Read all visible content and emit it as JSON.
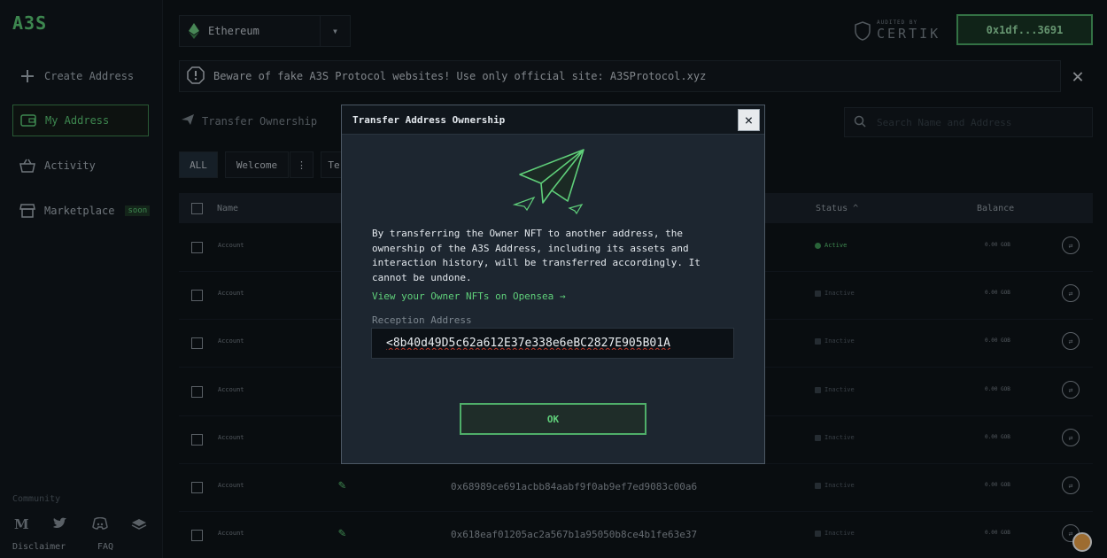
{
  "sidebar": {
    "logo": "A3S",
    "items": [
      {
        "label": "Create Address",
        "icon": "plus-icon"
      },
      {
        "label": "My Address",
        "icon": "wallet-icon"
      },
      {
        "label": "Activity",
        "icon": "basket-icon"
      },
      {
        "label": "Marketplace",
        "icon": "store-icon",
        "badge": "soon"
      }
    ],
    "community_label": "Community",
    "socials": [
      "medium-icon",
      "twitter-icon",
      "discord-icon",
      "gitbook-icon"
    ],
    "footer": {
      "disclaimer": "Disclaimer",
      "faq": "FAQ"
    }
  },
  "header": {
    "network": "Ethereum",
    "audit_small": "AUDITED BY",
    "audit_big": "CERTIK",
    "wallet": "0x1df...3691"
  },
  "banner": {
    "text": "Beware of fake A3S Protocol websites! Use only official site: A3SProtocol.xyz"
  },
  "toolbar": {
    "transfer_tab": "Transfer Ownership",
    "search_placeholder": "Search Name and Address",
    "filters": [
      "ALL",
      "Welcome",
      "⋮",
      "Te"
    ]
  },
  "table": {
    "headers": {
      "name": "Name",
      "status": "Status ^",
      "balance": "Balance"
    },
    "rows": [
      {
        "name": "Account",
        "address": "",
        "status": "Active",
        "balance": "0.00 GOB"
      },
      {
        "name": "Account",
        "address": "",
        "status": "Inactive",
        "balance": "0.00 GOB"
      },
      {
        "name": "Account",
        "address": "",
        "status": "Inactive",
        "balance": "0.00 GOB"
      },
      {
        "name": "Account",
        "address": "",
        "status": "Inactive",
        "balance": "0.00 GOB"
      },
      {
        "name": "Account",
        "address": "",
        "status": "Inactive",
        "balance": "0.00 GOB"
      },
      {
        "name": "Account",
        "address": "0x68989ce691acbb84aabf9f0ab9ef7ed9083c00a6",
        "status": "Inactive",
        "balance": "0.00 GOB"
      },
      {
        "name": "Account",
        "address": "0x618eaf01205ac2a567b1a95050b8ce4b1fe63e37",
        "status": "Inactive",
        "balance": "0.00 GOB"
      }
    ]
  },
  "modal": {
    "title": "Transfer Address Ownership",
    "close": "×",
    "body": "By transferring the Owner NFT to another address, the ownership of the A3S Address, including its assets and interaction history, will be transferred accordingly. It cannot be undone.",
    "link": "View your Owner NFTs on Opensea →",
    "field_label": "Reception Address",
    "field_value": "<8b40d49D5c62a612E37e338e6eBC2827E905B01A",
    "ok": "OK"
  },
  "colors": {
    "accent": "#5fcf7a",
    "background": "#0f1419",
    "modal": "#1d2630"
  }
}
